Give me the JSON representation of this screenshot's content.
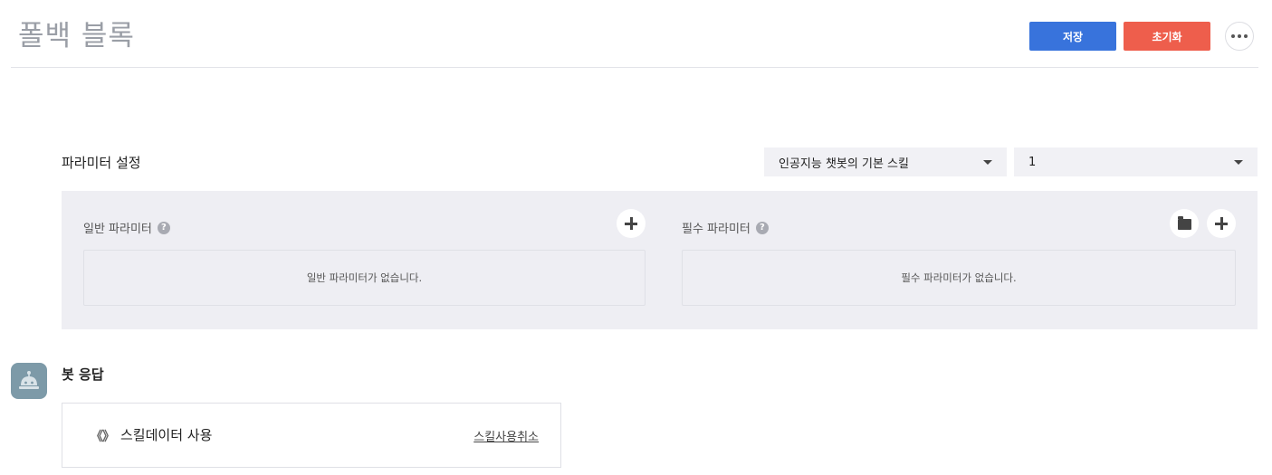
{
  "header": {
    "title": "폴백 블록",
    "save_label": "저장",
    "reset_label": "초기화",
    "more_icon": "ellipsis-icon"
  },
  "params": {
    "section_label": "파라미터 설정",
    "skill_select_value": "인공지능 챗봇의 기본 스킬",
    "version_select_value": "1",
    "general": {
      "label": "일반 파라미터",
      "help_glyph": "?",
      "empty_text": "일반 파라미터가 없습니다."
    },
    "required": {
      "label": "필수 파라미터",
      "help_glyph": "?",
      "empty_text": "필수 파라미터가 없습니다."
    }
  },
  "bot_response": {
    "label": "봇 응답",
    "card_icon": "《》",
    "card_title": "스킬데이터 사용",
    "cancel_link": "스킬사용취소"
  },
  "colors": {
    "save_button": "#3873dc",
    "reset_button": "#ee5e4c",
    "panel_background": "#eeeef3",
    "avatar_background": "#7d9aa8"
  }
}
